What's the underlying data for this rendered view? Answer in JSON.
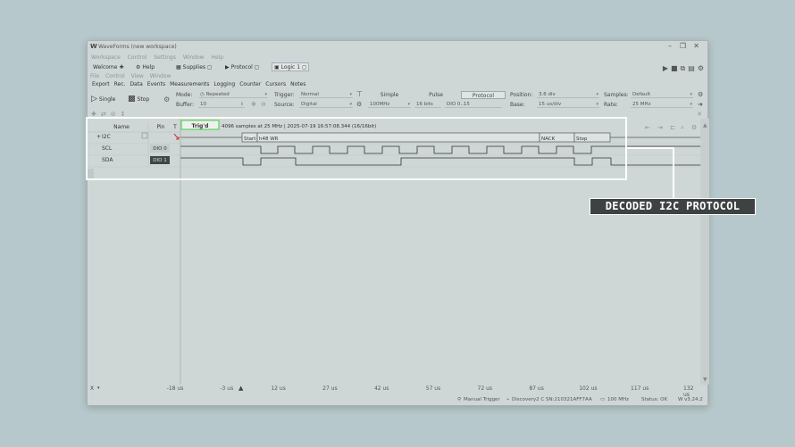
{
  "window": {
    "title": "WaveForms (new workspace)",
    "controls": [
      "–",
      "❐",
      "✕"
    ]
  },
  "menu_bar": [
    "Workspace",
    "Control",
    "Settings",
    "Window",
    "Help"
  ],
  "tabs": [
    {
      "label": "Welcome",
      "icon": "plus-icon"
    },
    {
      "label": "Help",
      "icon": "help-icon"
    },
    {
      "label": "Supplies",
      "icon": "supplies-icon"
    },
    {
      "label": "Protocol",
      "icon": "play-icon"
    },
    {
      "label": "Logic 1",
      "icon": "logic-icon"
    }
  ],
  "sub_menu": [
    "File",
    "Control",
    "View",
    "Window"
  ],
  "instrument_menu": [
    "Export",
    "Rec.",
    "Data",
    "Events",
    "Measurements",
    "Logging",
    "Counter",
    "Cursors",
    "Notes"
  ],
  "controls": {
    "single_label": "Single",
    "stop_label": "Stop",
    "mode_label": "Mode:",
    "mode_value": "Repeated",
    "buffer_label": "Buffer:",
    "buffer_value": "10",
    "trigger_label": "Trigger:",
    "trigger_value": "Normal",
    "source_label": "Source:",
    "source_value": "Digital",
    "simple_label": "Simple",
    "pulse_label": "Pulse",
    "protocol_label": "Protocol",
    "freq_value": "100MHz",
    "bits_value": "16 bits",
    "dio_value": "DIO 0..15",
    "position_label": "Position:",
    "position_value": "3.6 div",
    "base_label": "Base:",
    "base_value": "15 us/div",
    "samples_label": "Samples:",
    "samples_value": "Default",
    "rate_label": "Rate:",
    "rate_value": "25 MHz"
  },
  "channel_table": {
    "headers": {
      "name": "Name",
      "pin": "Pin",
      "t": "T"
    },
    "rows": [
      {
        "name": "I2C",
        "pin": "",
        "prefix": "+"
      },
      {
        "name": "SCL",
        "pin": "DIO 0"
      },
      {
        "name": "SDA",
        "pin": "DIO 1"
      }
    ]
  },
  "acquisition": {
    "status": "Trig'd",
    "info": "4096 samples at 25 MHz | 2025-07-19 16:57:08.344 (16/16bit)"
  },
  "decode": {
    "start": "Start",
    "address": "h48 WR",
    "nack": "NACK",
    "stop": "Stop"
  },
  "axis": {
    "prefix": "X",
    "ticks": [
      "-18 us",
      "-3 us",
      "12 us",
      "27 us",
      "42 us",
      "57 us",
      "72 us",
      "87 us",
      "102 us",
      "117 us",
      "132 us"
    ]
  },
  "status_bar": {
    "trigger": "Manual Trigger",
    "device": "Discovery2 C SN:210321AFF7AA",
    "clock": "100 MHz",
    "status": "Status: OK",
    "version": "v3.24.2"
  },
  "annotation": {
    "label": "DECODED I2C PROTOCOL"
  },
  "colors": {
    "trigger_box": "#5fd35f",
    "annotation_bg": "#3f4242",
    "background": "#b6c8cb"
  }
}
